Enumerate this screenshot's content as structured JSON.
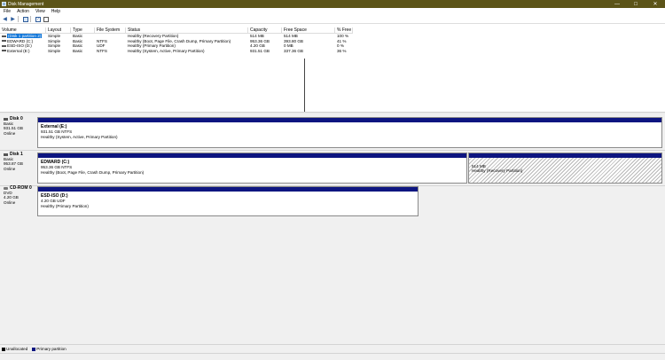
{
  "window": {
    "title": "Disk Management",
    "minimize": "—",
    "maximize": "☐",
    "close": "✕"
  },
  "menu": [
    "File",
    "Action",
    "View",
    "Help"
  ],
  "toolbar": {
    "back": "◀",
    "forward": "▶"
  },
  "volume_list": {
    "headers": [
      "Volume",
      "Layout",
      "Type",
      "File System",
      "Status",
      "Capacity",
      "Free Space",
      "% Free"
    ],
    "rows": [
      [
        "(Disk 1 partition 2)",
        "Simple",
        "Basic",
        "",
        "Healthy (Recovery Partition)",
        "514 MB",
        "514 MB",
        "100 %"
      ],
      [
        "EDWARD (C:)",
        "Simple",
        "Basic",
        "NTFS",
        "Healthy (Boot, Page File, Crash Dump, Primary Partition)",
        "953.36 GB",
        "393.80 GB",
        "41 %"
      ],
      [
        "ESD-ISO (D:)",
        "Simple",
        "Basic",
        "UDF",
        "Healthy (Primary Partition)",
        "4.20 GB",
        "0 MB",
        "0 %"
      ],
      [
        "External (E:)",
        "Simple",
        "Basic",
        "NTFS",
        "Healthy (System, Active, Primary Partition)",
        "931.51 GB",
        "337.36 GB",
        "36 %"
      ]
    ]
  },
  "disks": [
    {
      "name": "Disk 0",
      "type": "Basic",
      "size": "931.51 GB",
      "status": "Online",
      "partitions": [
        {
          "title": "External (E:)",
          "size": "931.51 GB NTFS",
          "status": "Healthy (System, Active, Primary Partition)"
        }
      ]
    },
    {
      "name": "Disk 1",
      "type": "Basic",
      "size": "953.87 GB",
      "status": "Online",
      "partitions": [
        {
          "title": "EDWARD (C:)",
          "size": "953.36 GB NTFS",
          "status": "Healthy (Boot, Page File, Crash Dump, Primary Partition)"
        },
        {
          "title": "",
          "size": "514 MB",
          "status": "Healthy (Recovery Partition)"
        }
      ]
    },
    {
      "name": "CD-ROM 0",
      "type": "DVD",
      "size": "4.20 GB",
      "status": "Online",
      "partitions": [
        {
          "title": "ESD-ISO (D:)",
          "size": "4.20 GB UDF",
          "status": "Healthy (Primary Partition)"
        }
      ]
    }
  ],
  "legend": [
    {
      "label": "Unallocated",
      "color": "#000000"
    },
    {
      "label": "Primary partition",
      "color": "#0d1580"
    }
  ]
}
